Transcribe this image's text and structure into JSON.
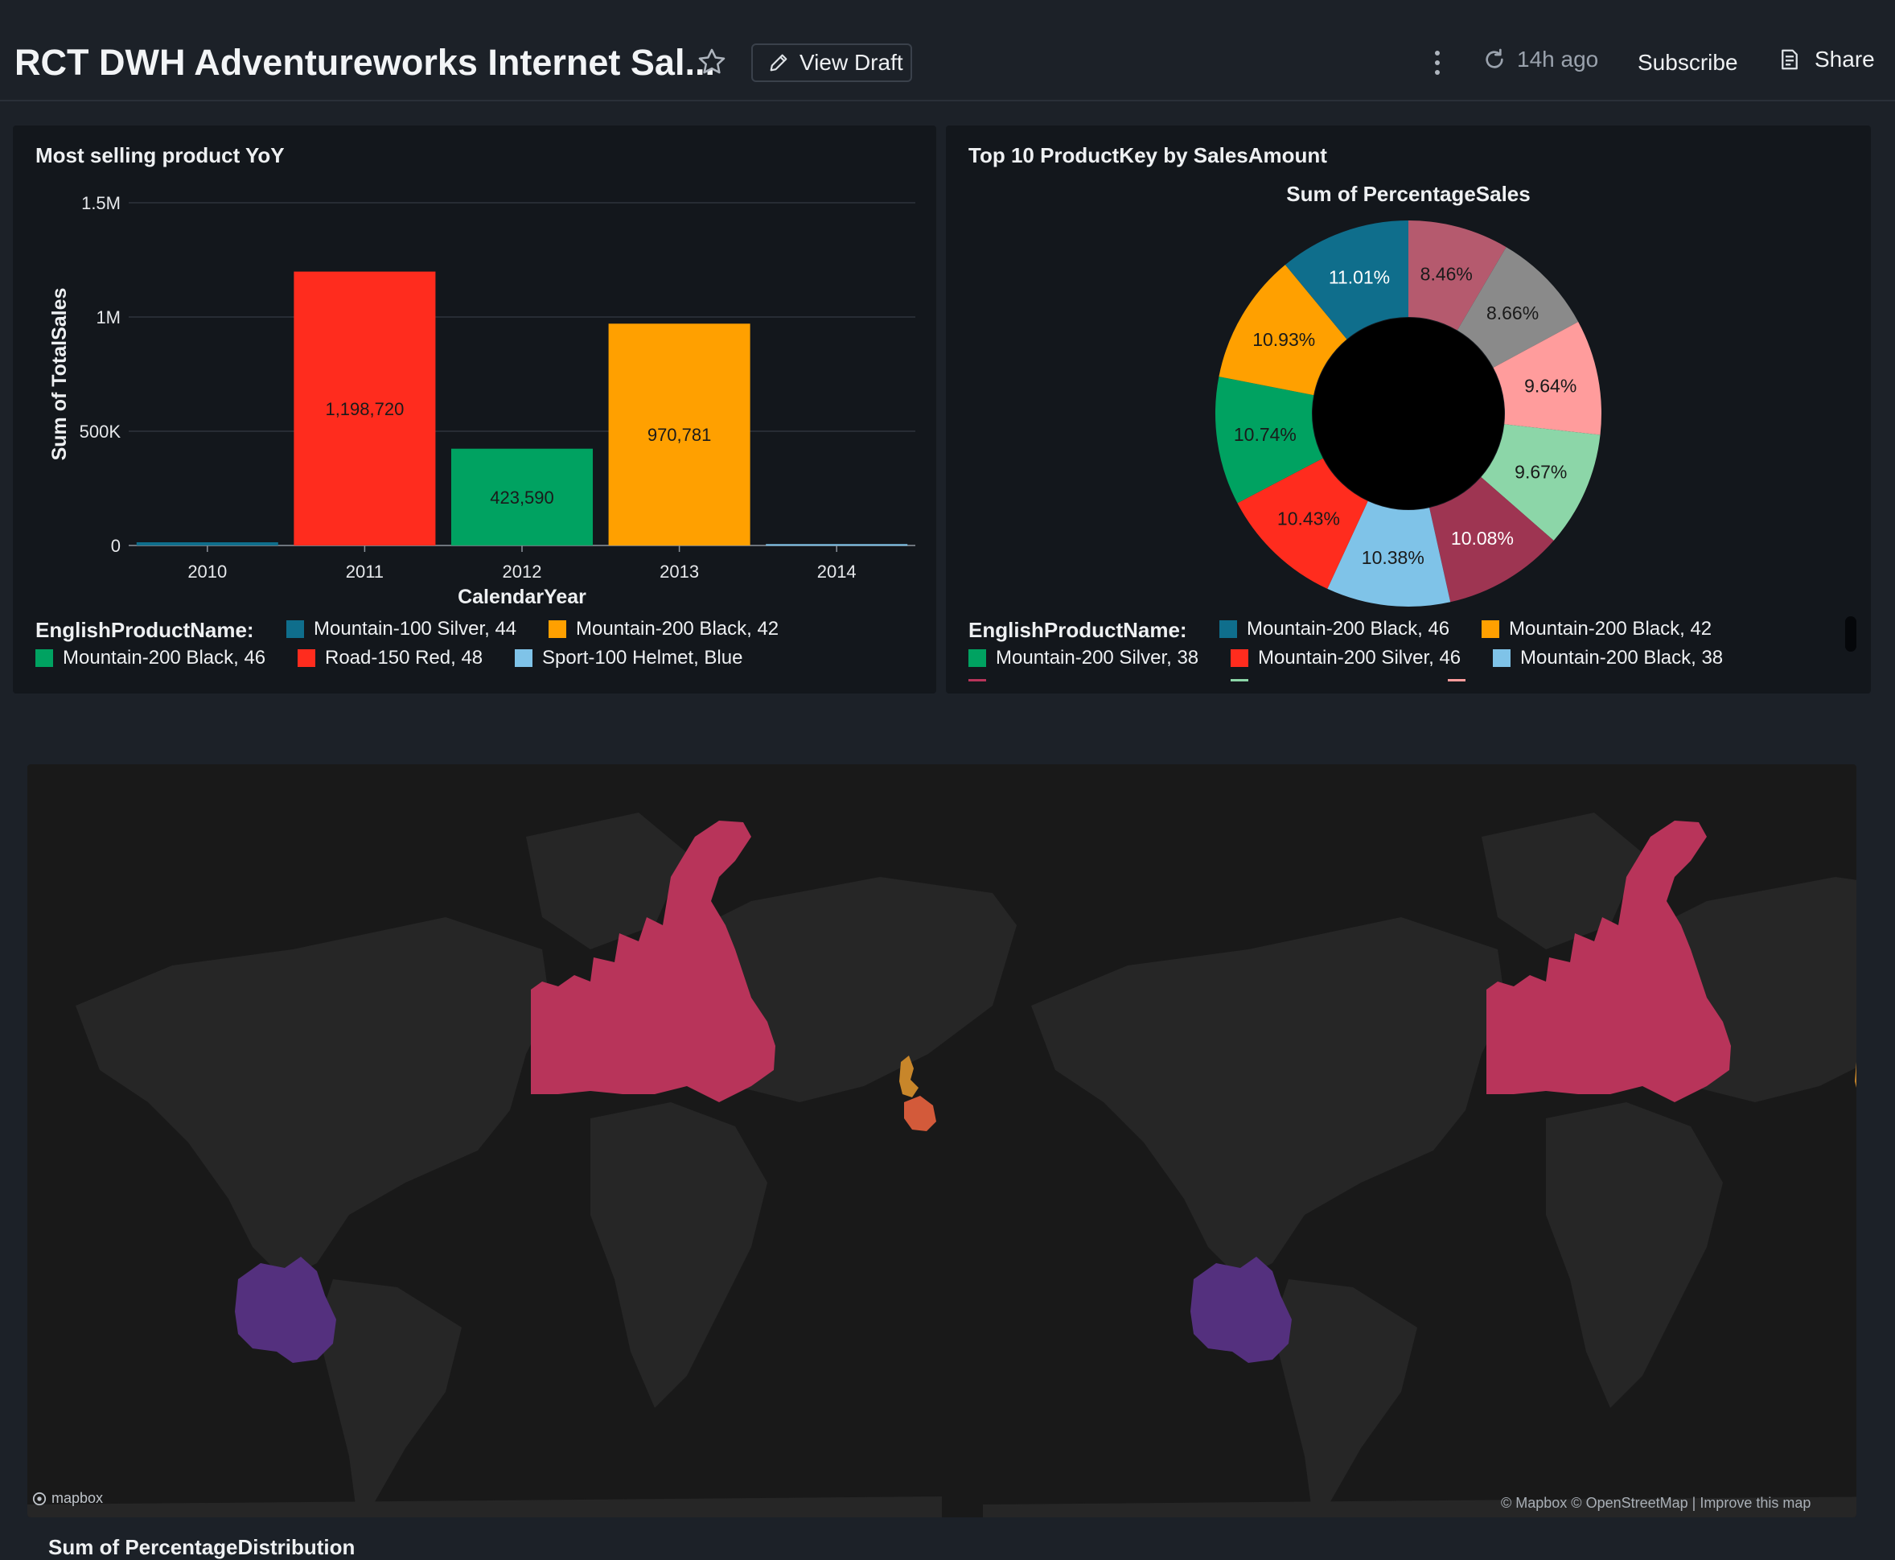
{
  "header": {
    "title": "RCT DWH Adventureworks Internet Sal...",
    "view_draft_label": "View Draft",
    "refresh_label": "14h ago",
    "subscribe_label": "Subscribe",
    "share_label": "Share"
  },
  "bar_panel": {
    "title": "Most selling product YoY",
    "legend_label": "EnglishProductName:",
    "legend": [
      {
        "name": "Mountain-100 Silver, 44",
        "color": "#0f6e8c"
      },
      {
        "name": "Mountain-200 Black, 42",
        "color": "#ffa000"
      },
      {
        "name": "Mountain-200 Black, 46",
        "color": "#00a261"
      },
      {
        "name": "Road-150 Red, 48",
        "color": "#ff2c1e"
      },
      {
        "name": "Sport-100 Helmet, Blue",
        "color": "#7fc3e8"
      }
    ]
  },
  "donut_panel": {
    "title": "Top 10 ProductKey by SalesAmount",
    "legend_label": "EnglishProductName:",
    "legend": [
      {
        "name": "Mountain-200 Black, 46",
        "color": "#0f6e8c"
      },
      {
        "name": "Mountain-200 Black, 42",
        "color": "#ffa000"
      },
      {
        "name": "Mountain-200 Silver, 38",
        "color": "#00a261"
      },
      {
        "name": "Mountain-200 Silver, 46",
        "color": "#ff2c1e"
      },
      {
        "name": "Mountain-200 Black, 38",
        "color": "#7fc3e8"
      }
    ]
  },
  "map": {
    "logo_label": "mapbox",
    "attribution": "© Mapbox © OpenStreetMap | Improve this map",
    "region_colors": {
      "canada": "#b8345a",
      "uk": "#c8862a",
      "france": "#d35a3a",
      "australia": "#54307e",
      "land": "#262626",
      "water": "#191919"
    }
  },
  "bottom_title": "Sum of PercentageDistribution",
  "chart_data": [
    {
      "type": "bar",
      "title": "Most selling product YoY",
      "categories": [
        "2010",
        "2011",
        "2012",
        "2013",
        "2014"
      ],
      "values": [
        14000,
        1198720,
        423590,
        970781,
        6000
      ],
      "data_labels": [
        "",
        "1,198,720",
        "423,590",
        "970,781",
        ""
      ],
      "colors": [
        "#0f6e8c",
        "#ff2c1e",
        "#00a261",
        "#ffa000",
        "#7fc3e8"
      ],
      "xlabel": "CalendarYear",
      "ylabel": "Sum of TotalSales",
      "ylim": [
        0,
        1500000
      ],
      "yticks": [
        0,
        500000,
        1000000,
        1500000
      ],
      "ytick_labels": [
        "0",
        "500K",
        "1M",
        "1.5M"
      ],
      "grid": true,
      "legend_position": "bottom"
    },
    {
      "type": "pie",
      "title": "Sum of PercentageSales",
      "values": [
        8.46,
        8.66,
        9.64,
        9.67,
        10.08,
        10.38,
        10.43,
        10.74,
        10.93,
        11.01
      ],
      "labels": [
        "8.46%",
        "8.66%",
        "9.64%",
        "9.67%",
        "10.08%",
        "10.38%",
        "10.43%",
        "10.74%",
        "10.93%",
        "11.01%"
      ],
      "colors": [
        "#b55a6e",
        "#8a8a8a",
        "#ff9c9c",
        "#8cd6a8",
        "#9e3552",
        "#7fc3e8",
        "#ff2c1e",
        "#00a261",
        "#ffa000",
        "#0f6e8c"
      ],
      "label_colors": [
        "#1a1a1a",
        "#1a1a1a",
        "#1a1a1a",
        "#1a1a1a",
        "#ffffff",
        "#1a1a1a",
        "#1a1a1a",
        "#1a1a1a",
        "#1a1a1a",
        "#ffffff"
      ],
      "donut": true,
      "legend_position": "bottom"
    }
  ]
}
